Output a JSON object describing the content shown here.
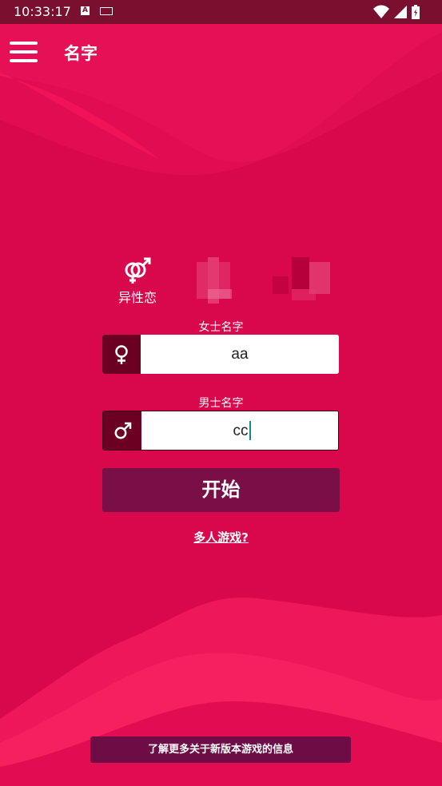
{
  "status_bar": {
    "time": "10:33:17",
    "a_icon": "A"
  },
  "app_bar": {
    "title": "名字",
    "menu_icon": "hamburger-menu-icon"
  },
  "mode": {
    "label": "异性恋",
    "icon": "heterosexual-gender-icon"
  },
  "female_field": {
    "label": "女士名字",
    "value": "aa",
    "icon": "female-symbol-icon"
  },
  "male_field": {
    "label": "男士名字",
    "value": "cc",
    "icon": "male-symbol-icon"
  },
  "start_button": {
    "label": "开始"
  },
  "multiplayer_link": {
    "label": "多人游戏?"
  },
  "bottom_button": {
    "label": "了解更多关于新版本游戏的信息"
  },
  "colors": {
    "background": "#d8064a",
    "status_bar": "#7a0f2f",
    "icon_box": "#6c0023",
    "button": "#7a0f48",
    "caret": "#168a8a"
  }
}
